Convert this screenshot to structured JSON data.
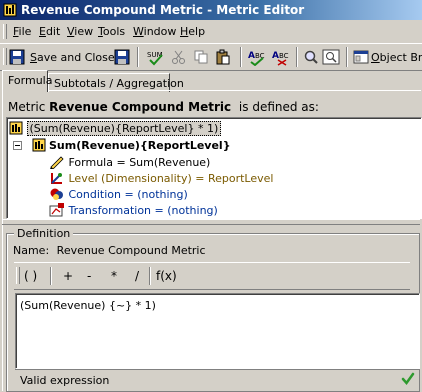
{
  "window": {
    "title": "Revenue Compound Metric - Metric Editor"
  },
  "menu": [
    {
      "label": "File",
      "key": "F",
      "rest": "ile"
    },
    {
      "label": "Edit",
      "key": "E",
      "rest": "dit"
    },
    {
      "label": "View",
      "key": "V",
      "rest": "iew"
    },
    {
      "label": "Tools",
      "key": "T",
      "rest": "ools"
    },
    {
      "label": "Window",
      "key": "W",
      "rest": "indow"
    },
    {
      "label": "Help",
      "key": "H",
      "rest": "elp"
    }
  ],
  "toolbar": {
    "save_close_label": "Save and Close",
    "save_key": "S",
    "object_browser_label": "Object Bro"
  },
  "tabs": [
    {
      "label": "Formula"
    },
    {
      "label": "Subtotals / Aggregation"
    }
  ],
  "metric_line": {
    "prefix": "Metric",
    "name": "Revenue Compound Metric",
    "suffix": "is defined as:"
  },
  "tree": {
    "root": "(Sum(Revenue){ReportLevel} * 1)",
    "node": "Sum(Revenue){ReportLevel}",
    "children": [
      {
        "label": "Formula = Sum(Revenue)"
      },
      {
        "label": "Level (Dimensionality) = ReportLevel"
      },
      {
        "label": "Condition = (nothing)"
      },
      {
        "label": "Transformation = (nothing)"
      }
    ]
  },
  "definition": {
    "legend": "Definition",
    "name_label": "Name:",
    "name_value": "Revenue Compound Metric",
    "operators": [
      "( )",
      "+",
      "-",
      "*",
      "/",
      "f(x)"
    ],
    "formula_text": "(Sum(Revenue) {~}  * 1)",
    "status": "Valid expression"
  },
  "colors": {
    "title_start": "#0a246a",
    "title_end": "#a6caf0",
    "face": "#d4d0c8",
    "valid_check": "#2e9a2e",
    "link_blue": "#003399"
  }
}
